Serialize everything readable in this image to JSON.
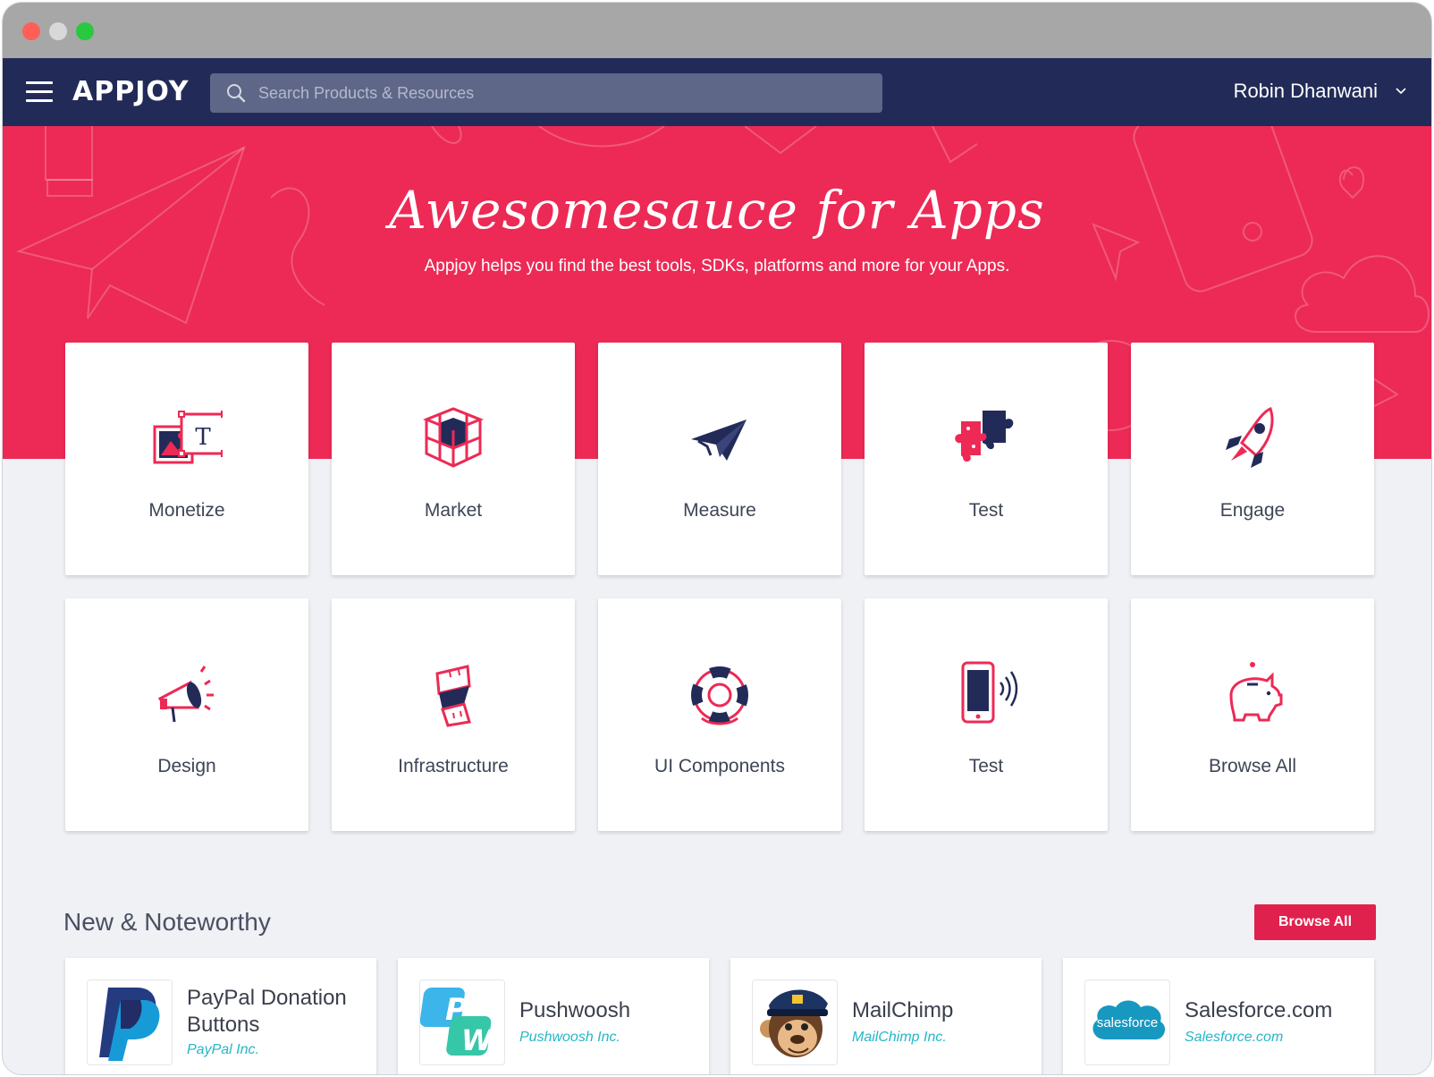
{
  "app": {
    "logo": "APPJOY"
  },
  "search": {
    "placeholder": "Search Products & Resources"
  },
  "user": {
    "name": "Robin Dhanwani"
  },
  "hero": {
    "title": "Awesomesauce for Apps",
    "subtitle": "Appjoy helps you find the best tools, SDKs, platforms and more for your Apps."
  },
  "categories": [
    {
      "label": "Monetize",
      "icon": "design-frame-icon"
    },
    {
      "label": "Market",
      "icon": "box-icon"
    },
    {
      "label": "Measure",
      "icon": "paper-plane-icon"
    },
    {
      "label": "Test",
      "icon": "puzzle-icon"
    },
    {
      "label": "Engage",
      "icon": "rocket-icon"
    },
    {
      "label": "Design",
      "icon": "megaphone-icon"
    },
    {
      "label": "Infrastructure",
      "icon": "tape-measure-icon"
    },
    {
      "label": "UI Components",
      "icon": "lifebuoy-icon"
    },
    {
      "label": "Test",
      "icon": "phone-signal-icon"
    },
    {
      "label": "Browse All",
      "icon": "piggy-bank-icon"
    }
  ],
  "section": {
    "title": "New & Noteworthy",
    "browse_label": "Browse All"
  },
  "products": [
    {
      "name": "PayPal Donation Buttons",
      "vendor": "PayPal Inc.",
      "icon": "paypal-logo"
    },
    {
      "name": "Pushwoosh",
      "vendor": "Pushwoosh Inc.",
      "icon": "pushwoosh-logo"
    },
    {
      "name": "MailChimp",
      "vendor": "MailChimp Inc.",
      "icon": "mailchimp-logo"
    },
    {
      "name": "Salesforce.com",
      "vendor": "Salesforce.com",
      "icon": "salesforce-logo"
    }
  ],
  "colors": {
    "navbar": "#222b58",
    "accent": "#ec2a55",
    "navy_icon": "#222b58",
    "vendor_text": "#25b6c8"
  }
}
